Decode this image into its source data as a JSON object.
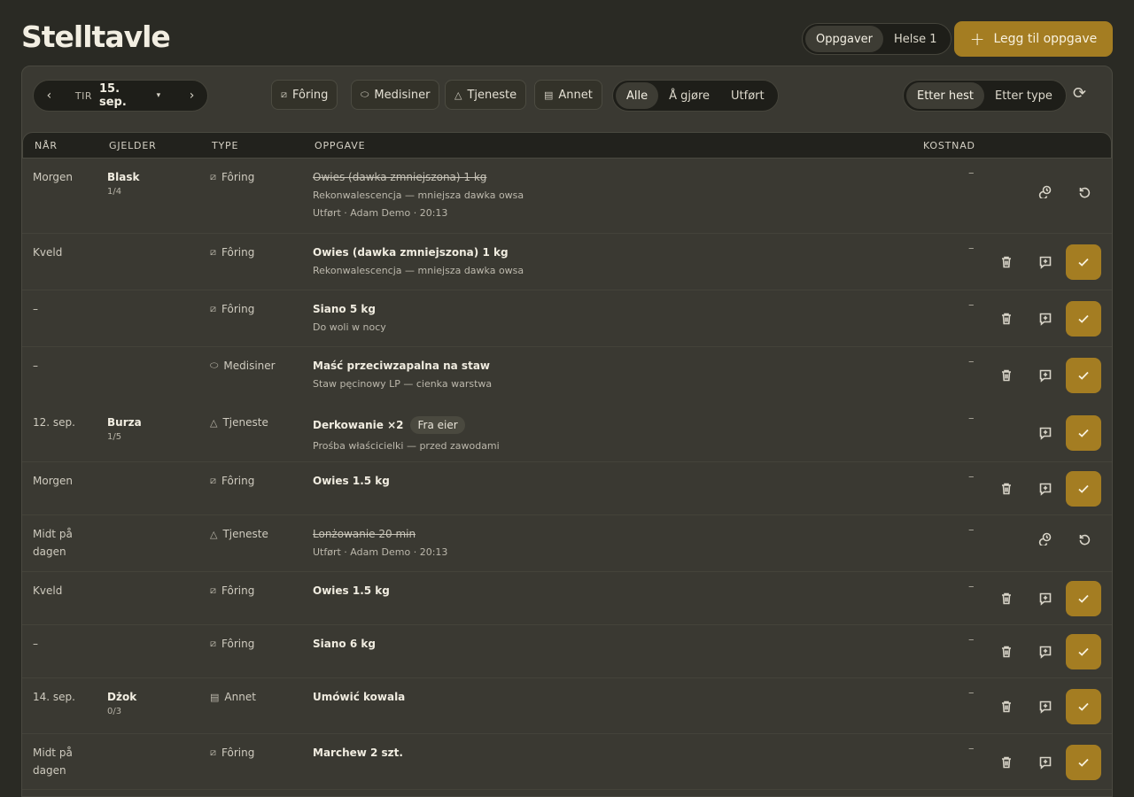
{
  "page_title": "Stelltavle",
  "view_tabs": [
    {
      "label": "Oppgaver",
      "active": true
    },
    {
      "label": "Helse 1",
      "active": false
    }
  ],
  "add_button": "Legg til oppgave",
  "date_nav": {
    "prev": "‹",
    "dow": "TIR",
    "date": "15. sep.",
    "next": "›"
  },
  "type_chips": [
    {
      "label": "Fôring",
      "icon": "feed-icon"
    },
    {
      "label": "Medisiner",
      "icon": "pill-icon"
    },
    {
      "label": "Tjeneste",
      "icon": "service-bell-icon"
    },
    {
      "label": "Annet",
      "icon": "clipboard-icon"
    }
  ],
  "status_filter": [
    {
      "label": "Alle",
      "active": true
    },
    {
      "label": "Å gjøre",
      "active": false
    },
    {
      "label": "Utført",
      "active": false
    }
  ],
  "group_by": [
    {
      "label": "Etter hest",
      "active": true
    },
    {
      "label": "Etter type",
      "active": false
    }
  ],
  "columns": [
    "NÅR",
    "GJELDER",
    "TYPE",
    "OPPGAVE",
    "KOSTNAD"
  ],
  "rows": [
    {
      "when": "Morgen",
      "horse": "Blask",
      "count": "1/4",
      "type": "Fôring",
      "task": "Owies (dawka zmniejszona) 1 kg",
      "sub": "Rekonwalescencja — mniejsza dawka owsa",
      "sub2": "Utført · Adam Demo · 20:13",
      "cost": "–",
      "done": true
    },
    {
      "when": "Kveld",
      "horse": "",
      "count": "",
      "type": "Fôring",
      "task": "Owies (dawka zmniejszona) 1 kg",
      "sub": "Rekonwalescencja — mniejsza dawka owsa",
      "cost": "–",
      "done": false
    },
    {
      "when": "–",
      "horse": "",
      "count": "",
      "type": "Fôring",
      "task": "Siano 5 kg",
      "sub": "Do woli w nocy",
      "cost": "–",
      "done": false
    },
    {
      "when": "–",
      "horse": "",
      "count": "",
      "type": "Medisiner",
      "task": "Maść przeciwzapalna na staw",
      "sub": "Staw pęcinowy LP — cienka warstwa",
      "cost": "–",
      "done": false
    },
    {
      "when": "12. sep.",
      "horse": "Burza",
      "count": "1/5",
      "type": "Tjeneste",
      "task": "Derkowanie ×2",
      "badge": "Fra eier",
      "sub": "Prośba właścicielki — przed zawodami",
      "cost": "–",
      "done": false
    },
    {
      "when": "Morgen",
      "horse": "",
      "count": "",
      "type": "Fôring",
      "task": "Owies 1.5 kg",
      "sub": "",
      "cost": "–",
      "done": false
    },
    {
      "when": "Midt på dagen",
      "horse": "",
      "count": "",
      "type": "Tjeneste",
      "task": "Lonżowanie 20 min",
      "sub": "Utført · Adam Demo · 20:13",
      "cost": "–",
      "done": true
    },
    {
      "when": "Kveld",
      "horse": "",
      "count": "",
      "type": "Fôring",
      "task": "Owies 1.5 kg",
      "sub": "",
      "cost": "–",
      "done": false
    },
    {
      "when": "–",
      "horse": "",
      "count": "",
      "type": "Fôring",
      "task": "Siano 6 kg",
      "sub": "",
      "cost": "–",
      "done": false
    },
    {
      "when": "14. sep.",
      "horse": "Dżok",
      "count": "0/3",
      "type": "Annet",
      "task": "Umówić kowala",
      "sub": "",
      "cost": "–",
      "done": false
    },
    {
      "when": "Midt på dagen",
      "horse": "",
      "count": "",
      "type": "Fôring",
      "task": "Marchew 2 szt.",
      "sub": "",
      "cost": "–",
      "done": false
    }
  ],
  "colors": {
    "accent": "#a47d22",
    "background": "#2a2a24",
    "panel": "#3a3932"
  }
}
